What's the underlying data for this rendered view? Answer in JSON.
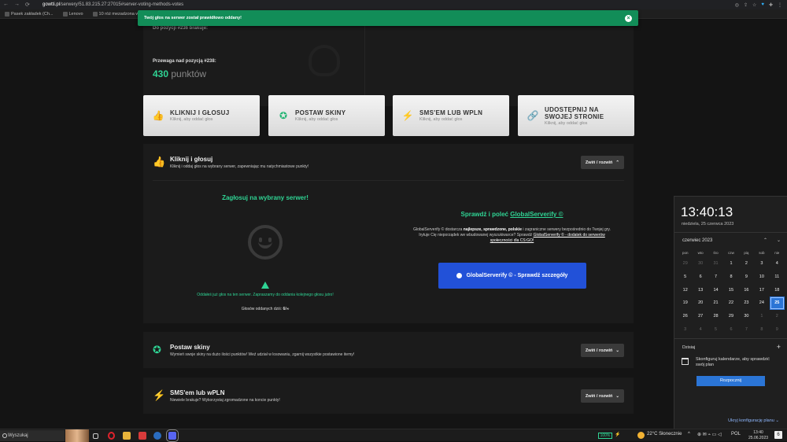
{
  "browser": {
    "url_domain": "gowtti.pl",
    "url_path": "/serwery/51.83.215.27:27015#server-voting-methods-votes",
    "bookmarks": [
      "Pasek zakładek (Ch...",
      "Lenovo",
      "10 róż mezadzona w...",
      "Widok moderatora...",
      "Barwy komunikacyj...",
      "Podanie na Admina...",
      "Komendy CS GO - ...",
      "(4) Podstawowe ko...",
      "Panel aktywności a...",
      "Kategoria.cs [ARENA...",
      "Administracja - Kat..."
    ]
  },
  "notification": {
    "text": "Twój głos na serwer został prawidłowo oddany!"
  },
  "stats": {
    "top_label": "Do pozycji #236 brakuje:",
    "advantage_label": "Przewaga nad pozycją #238:",
    "points_value": "430",
    "points_unit": "punktów"
  },
  "vote_methods": [
    {
      "title": "KLIKNIJ I GŁOSUJ",
      "sub": "Kliknij, aby oddać głos",
      "icon": "thumbs-up-icon"
    },
    {
      "title": "POSTAW SKINY",
      "sub": "Kliknij, aby oddać głos",
      "icon": "award-icon"
    },
    {
      "title": "SMS'EM LUB WPLN",
      "sub": "Kliknij, aby oddać głos",
      "icon": "bolt-icon"
    },
    {
      "title": "UDOSTĘPNIJ NA SWOJEJ STRONIE",
      "sub": "Kliknij, aby oddać głos",
      "icon": "link-icon"
    }
  ],
  "click_vote": {
    "title": "Kliknij i głosuj",
    "subtitle": "Kliknij i oddaj głos na wybrany serwer, zapewniając mu natychmiastowe punkty!",
    "toggle": "Zwiń / rozwiń",
    "left_heading": "Zagłosuj na wybrany serwer!",
    "already_voted": "Oddałeś już głos na ten serwer. Zapraszamy do oddania kolejnego głosu jutro!",
    "votes_today_label": "Głosów oddanych dziś:",
    "votes_today_value": "6/∞",
    "right_heading_prefix": "Sprawdź i poleć",
    "right_heading_link": "GlobalServerify ©",
    "desc_1": "GlobalServerify © dostarcza",
    "desc_bold": "najlepsze, sprawdzone, polskie",
    "desc_2": "i zagraniczne serwery bezpośrednio do Twojej gry. Irytuje Cię nieporządek we wbudowanej wyszukiwarce? Sprawdź",
    "desc_link": "GlobalServerify © - dodatek do serwerów społeczności dla CS:GO!",
    "button": "GlobalServerify © - Sprawdź szczegóły"
  },
  "skins": {
    "title": "Postaw skiny",
    "subtitle": "Wymień swoje skiny na dużo ilości punktów! Weź udział w losowaniu, zgarnij wszystkie postawione itemy!",
    "toggle": "Zwiń / rozwiń"
  },
  "sms": {
    "title": "SMS'em lub wPLN",
    "subtitle": "Niewiele brakuje? Wykorzystaj zgromadzone na koncie punkty!",
    "toggle": "Zwiń / rozwiń"
  },
  "calendar": {
    "time": "13:40:13",
    "date": "niedziela, 25 czerwca 2023",
    "month": "czerwiec 2023",
    "weekdays": [
      "pon",
      "wto",
      "śro",
      "czw",
      "pią",
      "sob",
      "nie"
    ],
    "days": [
      [
        "29",
        "o"
      ],
      [
        "30",
        "o"
      ],
      [
        "31",
        "o"
      ],
      [
        "1",
        ""
      ],
      [
        "2",
        ""
      ],
      [
        "3",
        ""
      ],
      [
        "4",
        ""
      ],
      [
        "5",
        ""
      ],
      [
        "6",
        ""
      ],
      [
        "7",
        ""
      ],
      [
        "8",
        ""
      ],
      [
        "9",
        ""
      ],
      [
        "10",
        ""
      ],
      [
        "11",
        ""
      ],
      [
        "12",
        ""
      ],
      [
        "13",
        ""
      ],
      [
        "14",
        ""
      ],
      [
        "15",
        ""
      ],
      [
        "16",
        ""
      ],
      [
        "17",
        ""
      ],
      [
        "18",
        ""
      ],
      [
        "19",
        ""
      ],
      [
        "20",
        ""
      ],
      [
        "21",
        ""
      ],
      [
        "22",
        ""
      ],
      [
        "23",
        ""
      ],
      [
        "24",
        ""
      ],
      [
        "25",
        "today"
      ],
      [
        "26",
        ""
      ],
      [
        "27",
        ""
      ],
      [
        "28",
        ""
      ],
      [
        "29",
        ""
      ],
      [
        "30",
        ""
      ],
      [
        "1",
        "o"
      ],
      [
        "2",
        "o"
      ],
      [
        "3",
        "o"
      ],
      [
        "4",
        "o"
      ],
      [
        "5",
        "o"
      ],
      [
        "6",
        "o"
      ],
      [
        "7",
        "o"
      ],
      [
        "8",
        "o"
      ],
      [
        "9",
        "o"
      ]
    ],
    "today_label": "Dzisiaj",
    "event_text": "Skonfiguruj kalendarze, aby sprawdzić swój plan",
    "start_button": "Rozpocznij",
    "config_link": "Ukryj konfigurację planu"
  },
  "taskbar": {
    "search_placeholder": "Wyszukaj",
    "battery": "100%",
    "weather": "22°C Słonecznie",
    "lang": "POL",
    "clock_time": "13:40",
    "clock_date": "25.06.2023"
  },
  "colors": {
    "accent_green": "#2fd494",
    "toast_green": "#128d58",
    "button_blue": "#2251d8",
    "today_blue": "#2b75d6"
  }
}
